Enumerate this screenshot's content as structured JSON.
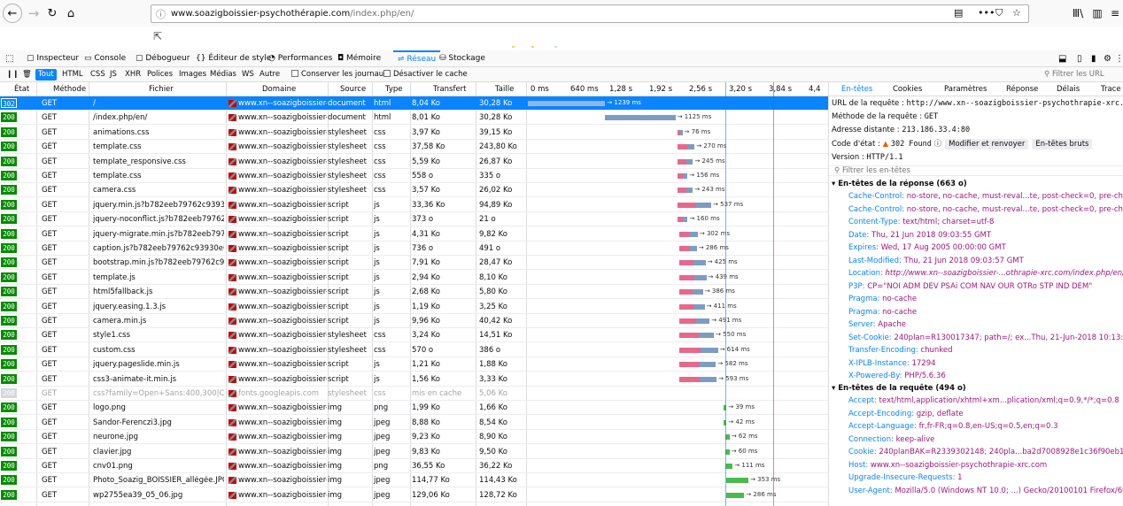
{
  "browser": {
    "url_host": "www.soazigboissier-psychothérapie.com",
    "url_path": "/index.php/en/",
    "dots": "•••"
  },
  "devtools": {
    "tabs": [
      "Inspecteur",
      "Console",
      "Débogueur",
      "Éditeur de style",
      "Performances",
      "Mémoire",
      "Réseau",
      "Stockage"
    ],
    "selected_tab": "Réseau",
    "filters": [
      "Tout",
      "HTML",
      "CSS",
      "JS",
      "XHR",
      "Polices",
      "Images",
      "Médias",
      "WS",
      "Autre"
    ],
    "persist_logs": "Conserver les journaux",
    "disable_cache": "Désactiver le cache",
    "filter_urls_placeholder": "Filtrer les URL"
  },
  "columns": {
    "status": "État",
    "method": "Méthode",
    "file": "Fichier",
    "domain": "Domaine",
    "cause": "Source",
    "type": "Type",
    "transferred": "Transfert",
    "size": "Taille"
  },
  "timeline_ticks": [
    "0 ms",
    "640 ms",
    "1,28 s",
    "1,92 s",
    "2,56 s",
    "3,20 s",
    "3,84 s",
    "4,4"
  ],
  "requests": [
    {
      "status": "302",
      "method": "GET",
      "file": "/",
      "domain": "www.xn--soazigboissier-p...",
      "cause": "document",
      "type": "html",
      "transferred": "8,04 Ko",
      "size": "30,28 Ko",
      "start": 0,
      "dur": 1239,
      "time": "→ 1239 ms",
      "selected": true
    },
    {
      "status": "200",
      "method": "GET",
      "file": "/index.php/en/",
      "domain": "www.xn--soazigboissier-p...",
      "cause": "document",
      "type": "html",
      "transferred": "8,01 Ko",
      "size": "30,28 Ko",
      "start": 1239,
      "dur": 1125,
      "time": "→ 1125 ms"
    },
    {
      "status": "200",
      "method": "GET",
      "file": "animations.css",
      "domain": "www.xn--soazigboissier-p...",
      "cause": "stylesheet",
      "type": "css",
      "transferred": "3,97 Ko",
      "size": "39,15 Ko",
      "start": 2400,
      "dur": 76,
      "time": "→ 76 ms"
    },
    {
      "status": "200",
      "method": "GET",
      "file": "template.css",
      "domain": "www.xn--soazigboissier-p...",
      "cause": "stylesheet",
      "type": "css",
      "transferred": "37,58 Ko",
      "size": "243,80 Ko",
      "start": 2400,
      "dur": 270,
      "time": "→ 270 ms"
    },
    {
      "status": "200",
      "method": "GET",
      "file": "template_responsive.css",
      "domain": "www.xn--soazigboissier-p...",
      "cause": "stylesheet",
      "type": "css",
      "transferred": "5,59 Ko",
      "size": "26,87 Ko",
      "start": 2400,
      "dur": 245,
      "time": "→ 245 ms"
    },
    {
      "status": "200",
      "method": "GET",
      "file": "template.css",
      "domain": "www.xn--soazigboissier-p...",
      "cause": "stylesheet",
      "type": "css",
      "transferred": "558 o",
      "size": "335 o",
      "start": 2400,
      "dur": 156,
      "time": "→ 156 ms"
    },
    {
      "status": "200",
      "method": "GET",
      "file": "camera.css",
      "domain": "www.xn--soazigboissier-p...",
      "cause": "stylesheet",
      "type": "css",
      "transferred": "3,57 Ko",
      "size": "26,02 Ko",
      "start": 2400,
      "dur": 243,
      "time": "→ 243 ms"
    },
    {
      "status": "200",
      "method": "GET",
      "file": "jquery.min.js?b782eeb79762c93930e661...",
      "domain": "www.xn--soazigboissier-p...",
      "cause": "script",
      "type": "js",
      "transferred": "33,36 Ko",
      "size": "94,89 Ko",
      "start": 2400,
      "dur": 537,
      "time": "→ 537 ms"
    },
    {
      "status": "200",
      "method": "GET",
      "file": "jquery-noconflict.js?b782eeb79762c939...",
      "domain": "www.xn--soazigboissier-p...",
      "cause": "script",
      "type": "js",
      "transferred": "373 o",
      "size": "21 o",
      "start": 2400,
      "dur": 160,
      "time": "→ 160 ms"
    },
    {
      "status": "200",
      "method": "GET",
      "file": "jquery-migrate.min.js?b782eeb79762c9...",
      "domain": "www.xn--soazigboissier-p...",
      "cause": "script",
      "type": "js",
      "transferred": "4,31 Ko",
      "size": "9,82 Ko",
      "start": 2420,
      "dur": 302,
      "time": "→ 302 ms"
    },
    {
      "status": "200",
      "method": "GET",
      "file": "caption.js?b782eeb79762c93930e661575...",
      "domain": "www.xn--soazigboissier-p...",
      "cause": "script",
      "type": "js",
      "transferred": "736 o",
      "size": "491 o",
      "start": 2420,
      "dur": 286,
      "time": "→ 286 ms"
    },
    {
      "status": "200",
      "method": "GET",
      "file": "bootstrap.min.js?b782eeb79762c93930e...",
      "domain": "www.xn--soazigboissier-p...",
      "cause": "script",
      "type": "js",
      "transferred": "7,91 Ko",
      "size": "28,47 Ko",
      "start": 2420,
      "dur": 425,
      "time": "→ 425 ms"
    },
    {
      "status": "200",
      "method": "GET",
      "file": "template.js",
      "domain": "www.xn--soazigboissier-p...",
      "cause": "script",
      "type": "js",
      "transferred": "2,94 Ko",
      "size": "8,10 Ko",
      "start": 2420,
      "dur": 439,
      "time": "→ 439 ms"
    },
    {
      "status": "200",
      "method": "GET",
      "file": "html5fallback.js",
      "domain": "www.xn--soazigboissier-p...",
      "cause": "script",
      "type": "js",
      "transferred": "2,68 Ko",
      "size": "5,80 Ko",
      "start": 2420,
      "dur": 386,
      "time": "→ 386 ms"
    },
    {
      "status": "200",
      "method": "GET",
      "file": "jquery.easing.1.3.js",
      "domain": "www.xn--soazigboissier-p...",
      "cause": "script",
      "type": "js",
      "transferred": "1,19 Ko",
      "size": "3,25 Ko",
      "start": 2420,
      "dur": 411,
      "time": "→ 411 ms"
    },
    {
      "status": "200",
      "method": "GET",
      "file": "camera.min.js",
      "domain": "www.xn--soazigboissier-p...",
      "cause": "script",
      "type": "js",
      "transferred": "9,96 Ko",
      "size": "40,42 Ko",
      "start": 2420,
      "dur": 491,
      "time": "→ 491 ms"
    },
    {
      "status": "200",
      "method": "GET",
      "file": "style1.css",
      "domain": "www.xn--soazigboissier-p...",
      "cause": "stylesheet",
      "type": "css",
      "transferred": "3,24 Ko",
      "size": "14,51 Ko",
      "start": 2430,
      "dur": 550,
      "time": "→ 550 ms"
    },
    {
      "status": "200",
      "method": "GET",
      "file": "custom.css",
      "domain": "www.xn--soazigboissier-p...",
      "cause": "stylesheet",
      "type": "css",
      "transferred": "570 o",
      "size": "386 o",
      "start": 2430,
      "dur": 614,
      "time": "→ 614 ms"
    },
    {
      "status": "200",
      "method": "GET",
      "file": "jquery.pageslide.min.js",
      "domain": "www.xn--soazigboissier-p...",
      "cause": "script",
      "type": "js",
      "transferred": "1,21 Ko",
      "size": "1,88 Ko",
      "start": 2430,
      "dur": 582,
      "time": "→ 582 ms"
    },
    {
      "status": "200",
      "method": "GET",
      "file": "css3-animate-it.min.js",
      "domain": "www.xn--soazigboissier-p...",
      "cause": "script",
      "type": "js",
      "transferred": "1,56 Ko",
      "size": "3,33 Ko",
      "start": 2430,
      "dur": 593,
      "time": "→ 593 ms"
    },
    {
      "status": "200",
      "method": "GET",
      "file": "css?family=Open+Sans:400,300|Comin...",
      "domain": "fonts.googleapis.com",
      "cause": "stylesheet",
      "type": "css",
      "transferred": "mis en cache",
      "size": "5,06 Ko",
      "cached": true
    },
    {
      "status": "200",
      "method": "GET",
      "file": "logo.png",
      "domain": "www.xn--soazigboissier-p...",
      "cause": "img",
      "type": "png",
      "transferred": "1,99 Ko",
      "size": "1,66 Ko",
      "start": 3140,
      "dur": 39,
      "time": "→ 39 ms",
      "img": true
    },
    {
      "status": "200",
      "method": "GET",
      "file": "Sandor-Ferenczi3.jpg",
      "domain": "www.xn--soazigboissier-p...",
      "cause": "img",
      "type": "jpeg",
      "transferred": "8,88 Ko",
      "size": "8,54 Ko",
      "start": 3140,
      "dur": 42,
      "time": "→ 42 ms",
      "img": true
    },
    {
      "status": "200",
      "method": "GET",
      "file": "neurone.jpg",
      "domain": "www.xn--soazigboissier-p...",
      "cause": "img",
      "type": "jpeg",
      "transferred": "9,23 Ko",
      "size": "8,90 Ko",
      "start": 3170,
      "dur": 62,
      "time": "→ 62 ms",
      "img": true
    },
    {
      "status": "200",
      "method": "GET",
      "file": "clavier.jpg",
      "domain": "www.xn--soazigboissier-p...",
      "cause": "img",
      "type": "jpeg",
      "transferred": "9,83 Ko",
      "size": "9,50 Ko",
      "start": 3170,
      "dur": 60,
      "time": "→ 60 ms",
      "img": true
    },
    {
      "status": "200",
      "method": "GET",
      "file": "cnv01.png",
      "domain": "www.xn--soazigboissier-p...",
      "cause": "img",
      "type": "png",
      "transferred": "36,55 Ko",
      "size": "36,22 Ko",
      "start": 3170,
      "dur": 111,
      "time": "→ 111 ms",
      "img": true
    },
    {
      "status": "200",
      "method": "GET",
      "file": "Photo_Soazig_BOISSIER_allégée.JPG",
      "domain": "www.xn--soazigboissier-p...",
      "cause": "img",
      "type": "jpeg",
      "transferred": "114,77 Ko",
      "size": "114,43 Ko",
      "start": 3180,
      "dur": 353,
      "time": "→ 353 ms",
      "img": true
    },
    {
      "status": "200",
      "method": "GET",
      "file": "wp2755ea39_05_06.jpg",
      "domain": "www.xn--soazigboissier-p...",
      "cause": "img",
      "type": "jpeg",
      "transferred": "129,06 Ko",
      "size": "128,72 Ko",
      "start": 3180,
      "dur": 286,
      "time": "→ 286 ms",
      "img": true
    }
  ],
  "panel": {
    "tabs": [
      "En-têtes",
      "Cookies",
      "Paramètres",
      "Réponse",
      "Délais",
      "Trace c"
    ],
    "url_label": "URL de la requête :",
    "url_value": "http://www.xn--soazigboissier-psychothrapie-xrc.com/",
    "method_label": "Méthode de la requête :",
    "method_value": "GET",
    "remote_label": "Adresse distante :",
    "remote_value": "213.186.33.4:80",
    "status_label": "Code d'état :",
    "status_value": "302 Found",
    "edit_resend": "Modifier et renvoyer",
    "raw_headers": "En-têtes bruts",
    "version_label": "Version :",
    "version_value": "HTTP/1.1",
    "filter_headers": "Filtrer les en-têtes",
    "response_section": "En-têtes de la réponse (663 o)",
    "response_headers": [
      {
        "k": "Cache-Control:",
        "v": "no-store, no-cache, must-reval...te, post-check=0, pre-check=0"
      },
      {
        "k": "Cache-Control:",
        "v": "no-store, no-cache, must-reval...te, post-check=0, pre-check=0"
      },
      {
        "k": "Content-Type:",
        "v": "text/html; charset=utf-8"
      },
      {
        "k": "Date:",
        "v": "Thu, 21 Jun 2018 09:03:55 GMT"
      },
      {
        "k": "Expires:",
        "v": "Wed, 17 Aug 2005 00:00:00 GMT"
      },
      {
        "k": "Last-Modified:",
        "v": "Thu, 21 Jun 2018 09:03:57 GMT"
      },
      {
        "k": "Location:",
        "v": "http://www.xn--soazigboissier-...othrapie-xrc.com/index.php/en/",
        "italic": true
      },
      {
        "k": "P3P:",
        "v": "CP=\"NOI ADM DEV PSAi COM NAV OUR OTRo STP IND DEM\"",
        "plain": true
      },
      {
        "k": "Pragma:",
        "v": "no-cache"
      },
      {
        "k": "Pragma:",
        "v": "no-cache"
      },
      {
        "k": "Server:",
        "v": "Apache"
      },
      {
        "k": "Set-Cookie:",
        "v": "240plan=R130017347; path=/; ex...Thu, 21-Jun-2018 10:13:27 GMT"
      },
      {
        "k": "Transfer-Encoding:",
        "v": "chunked"
      },
      {
        "k": "X-IPLB-Instance:",
        "v": "17294"
      },
      {
        "k": "X-Powered-By:",
        "v": "PHP/5.6.36"
      }
    ],
    "request_section": "En-têtes de la requête (494 o)",
    "request_headers": [
      {
        "k": "Accept:",
        "v": "text/html,application/xhtml+xm...plication/xml;q=0.9,*/*;q=0.8"
      },
      {
        "k": "Accept-Encoding:",
        "v": "gzip, deflate"
      },
      {
        "k": "Accept-Language:",
        "v": "fr,fr-FR;q=0.8,en-US;q=0.5,en;q=0.3"
      },
      {
        "k": "Connection:",
        "v": "keep-alive"
      },
      {
        "k": "Cookie:",
        "v": "240planBAK=R2339302148; 240pla...ba2d7008928e1c36f90eb12f5984e"
      },
      {
        "k": "Host:",
        "v": "www.xn--soazigboissier-psychothrapie-xrc.com"
      },
      {
        "k": "Upgrade-Insecure-Requests:",
        "v": "1"
      },
      {
        "k": "User-Agent:",
        "v": "Mozilla/5.0 (Windows NT 10.0; ...) Gecko/20100101 Firefox/60.0"
      }
    ]
  }
}
